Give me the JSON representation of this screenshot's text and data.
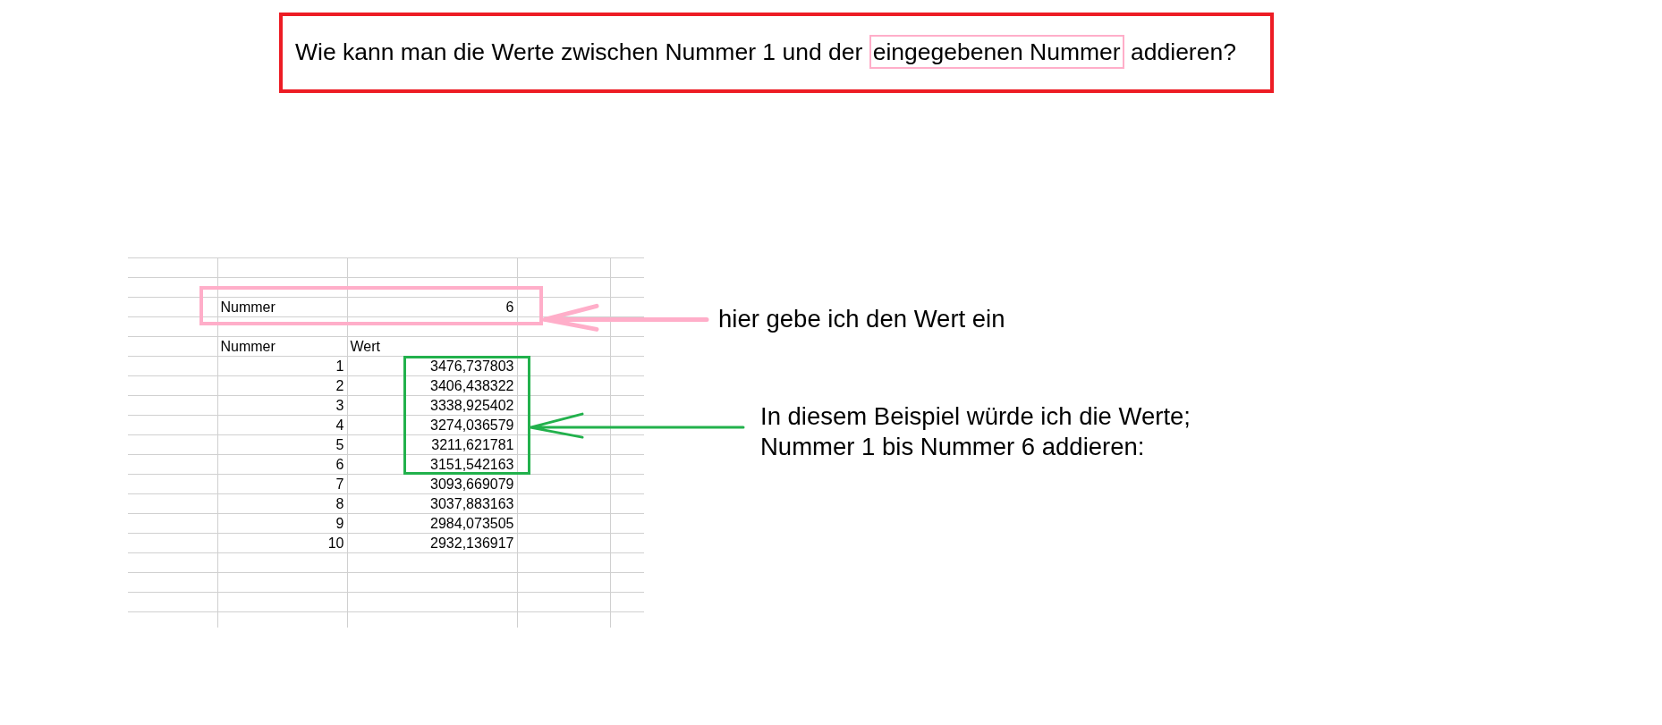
{
  "question": {
    "color": "#ed1c24",
    "segments": [
      {
        "text": "Wie kann man die Werte zwischen Nummer 1 und der",
        "highlighted": false
      },
      {
        "text": "eingegebenen Nummer",
        "highlighted": true
      },
      {
        "text": "addieren?",
        "highlighted": false
      }
    ]
  },
  "sheet": {
    "input_row": {
      "label": "Nummer",
      "value": "6",
      "highlighted": true
    },
    "columns": [
      "Nummer",
      "Wert"
    ],
    "rows": [
      {
        "nummer": "1",
        "wert": "3476,737803",
        "highlighted": true
      },
      {
        "nummer": "2",
        "wert": "3406,438322",
        "highlighted": true
      },
      {
        "nummer": "3",
        "wert": "3338,925402",
        "highlighted": true
      },
      {
        "nummer": "4",
        "wert": "3274,036579",
        "highlighted": true
      },
      {
        "nummer": "5",
        "wert": "3211,621781",
        "highlighted": true
      },
      {
        "nummer": "6",
        "wert": "3151,542163",
        "highlighted": true
      },
      {
        "nummer": "7",
        "wert": "3093,669079",
        "highlighted": false
      },
      {
        "nummer": "8",
        "wert": "3037,883163",
        "highlighted": false
      },
      {
        "nummer": "9",
        "wert": "2984,073505",
        "highlighted": false
      },
      {
        "nummer": "10",
        "wert": "2932,136917",
        "highlighted": false
      }
    ]
  },
  "annotations": [
    {
      "kind": "input",
      "color": "#ffaec9",
      "lines": [
        "hier gebe ich den Wert ein"
      ]
    },
    {
      "kind": "rows",
      "color": "#22b14c",
      "lines": [
        "In diesem Beispiel würde ich die Werte;",
        "Nummer 1 bis Nummer 6 addieren:"
      ]
    }
  ]
}
